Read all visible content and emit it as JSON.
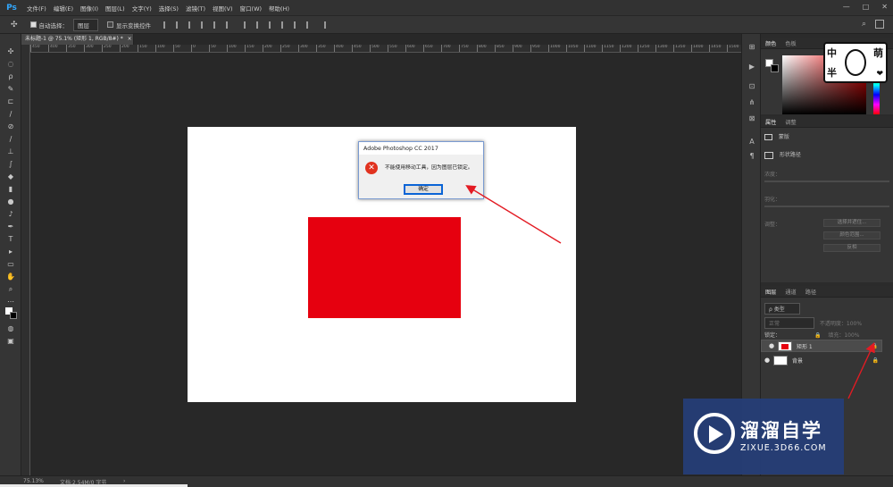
{
  "menu": {
    "logo": "Ps",
    "items": [
      "文件(F)",
      "编辑(E)",
      "图像(I)",
      "图层(L)",
      "文字(Y)",
      "选择(S)",
      "滤镜(T)",
      "视图(V)",
      "窗口(W)",
      "帮助(H)"
    ],
    "controls": [
      "—",
      "□",
      "✕"
    ]
  },
  "options": {
    "auto_select_label": "自动选择：",
    "auto_select_value": "图层",
    "show_transform_label": "显示变换控件"
  },
  "document": {
    "tab_label": "未标题-1 @ 75.1% (矩形 1, RGB/8#) *",
    "tab_close": "×"
  },
  "ruler": [
    "450",
    "400",
    "350",
    "300",
    "250",
    "200",
    "150",
    "100",
    "50",
    "0",
    "50",
    "100",
    "150",
    "200",
    "250",
    "300",
    "350",
    "400",
    "450",
    "500",
    "550",
    "600",
    "650",
    "700",
    "750",
    "800",
    "850",
    "900",
    "950",
    "1000",
    "1050",
    "1100",
    "1150",
    "1200",
    "1250",
    "1300",
    "1350",
    "1400",
    "1450",
    "1500"
  ],
  "dialog": {
    "title": "Adobe Photoshop CC 2017",
    "error_glyph": "✕",
    "message": "不能使用移动工具，因为图层已锁定。",
    "ok_label": "确定"
  },
  "panels": {
    "color_tabs": [
      "颜色",
      "色板"
    ],
    "sticker": {
      "tl": "中",
      "bl": "半",
      "tr": "萌",
      "heart": "❤"
    },
    "props_tabs": [
      "属性",
      "调整"
    ],
    "props_type": "蒙版",
    "props_sub": "形状路径",
    "props_rows": [
      "浓度：",
      "羽化：",
      "调整："
    ],
    "props_buttons": [
      "选择并遮住...",
      "颜色范围...",
      "反相"
    ],
    "layers_tabs": [
      "图层",
      "通道",
      "路径"
    ],
    "filter_label": "ρ 类型",
    "blend_mode": "正常",
    "opacity_label": "不透明度：100%",
    "lock_label": "锁定：",
    "fill_label": "填充：100%",
    "layers": [
      {
        "name": "矩形 1",
        "selected": true
      },
      {
        "name": "背景",
        "selected": false
      }
    ]
  },
  "watermark": {
    "title": "溜溜自学",
    "url": "ZIXUE.3D66.COM"
  },
  "status": {
    "zoom": "75.13%",
    "doc": "文档:2.54M/0 字节",
    "arrow": "›"
  },
  "colors": {
    "red_shape": "#e6000f",
    "annotation": "#e31b23",
    "watermark_bg": "#263e78"
  }
}
